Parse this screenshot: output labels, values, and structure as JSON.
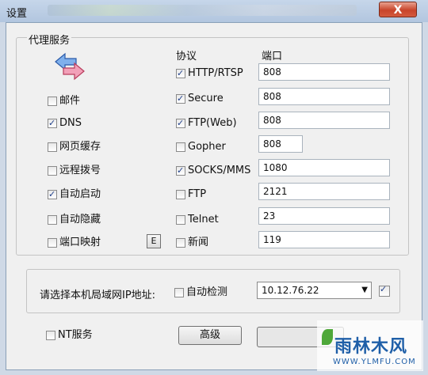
{
  "window": {
    "title": "设置",
    "close_label": "X"
  },
  "proxy_group": {
    "title": "代理服务"
  },
  "left_options": [
    {
      "label": "邮件",
      "checked": false
    },
    {
      "label": "DNS",
      "checked": true
    },
    {
      "label": "网页缓存",
      "checked": false
    },
    {
      "label": "远程拨号",
      "checked": false
    },
    {
      "label": "自动启动",
      "checked": true
    },
    {
      "label": "自动隐藏",
      "checked": false
    },
    {
      "label": "端口映射",
      "checked": false
    }
  ],
  "e_button_label": "E",
  "protocol_header": "协议",
  "port_header": "端口",
  "protocols": [
    {
      "label": "HTTP/RTSP",
      "checked": true,
      "port": "808"
    },
    {
      "label": "Secure",
      "checked": true,
      "port": "808"
    },
    {
      "label": "FTP(Web)",
      "checked": true,
      "port": "808"
    },
    {
      "label": "Gopher",
      "checked": false,
      "port": "808"
    },
    {
      "label": "SOCKS/MMS",
      "checked": true,
      "port": "1080"
    },
    {
      "label": "FTP",
      "checked": false,
      "port": "2121"
    },
    {
      "label": "Telnet",
      "checked": false,
      "port": "23"
    },
    {
      "label": "新闻",
      "checked": false,
      "port": "119"
    }
  ],
  "lan_ip": {
    "prompt": "请选择本机局域网IP地址:",
    "auto_detect_label": "自动检测",
    "auto_detect_checked": false,
    "selected_ip": "10.12.76.22",
    "confirm_checked": true
  },
  "nt_service": {
    "label": "NT服务",
    "checked": false
  },
  "advanced_button": "高级",
  "watermark": {
    "brand": "雨林木风",
    "url": "WWW.YLMFU.COM"
  },
  "colors": {
    "accent_check": "#1f3f8a",
    "close_button": "#c8442a"
  }
}
